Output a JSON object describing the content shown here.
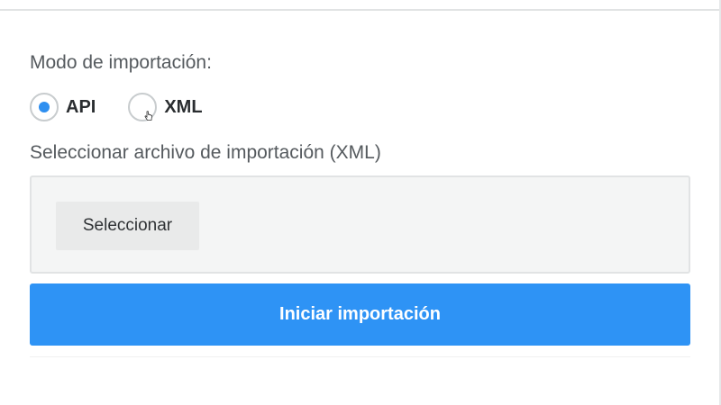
{
  "import_form": {
    "mode_label": "Modo de importación:",
    "mode_options": [
      {
        "label": "API",
        "selected": true
      },
      {
        "label": "XML",
        "selected": false
      }
    ],
    "file_label": "Seleccionar archivo de importación (XML)",
    "select_button_label": "Seleccionar",
    "start_button_label": "Iniciar importación"
  },
  "colors": {
    "accent": "#2e93f5",
    "radio_selected": "#2e8ff0",
    "file_box_bg": "#f4f5f5",
    "select_button_bg": "#e9eaea"
  },
  "icons": {
    "pointer": "hand-pointer-icon"
  }
}
